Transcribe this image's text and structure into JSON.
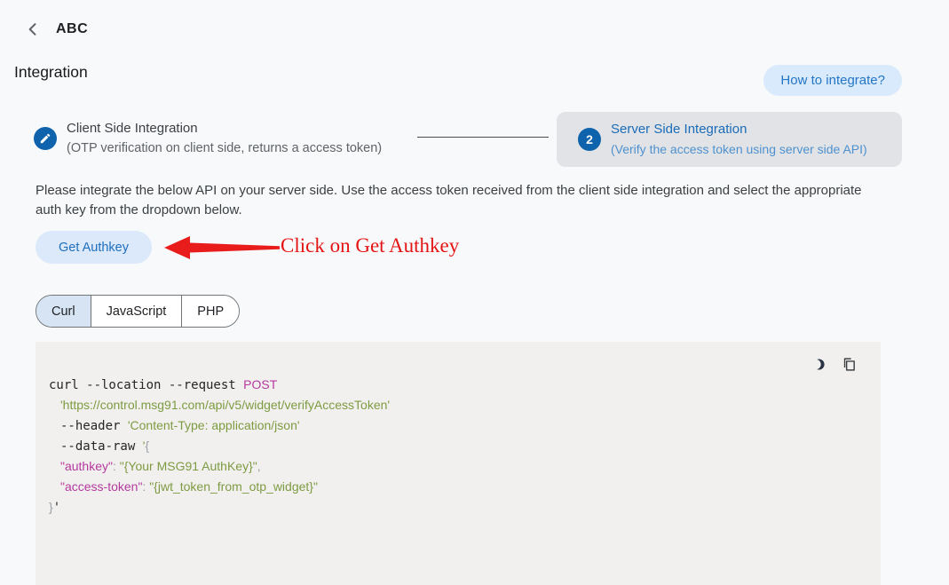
{
  "header": {
    "back_icon": "chevron-left",
    "title": "ABC"
  },
  "page": {
    "title": "Integration",
    "how_to_button": "How to integrate?"
  },
  "steps": {
    "client": {
      "icon": "pencil-icon",
      "title": "Client Side Integration",
      "subtitle": "(OTP verification on client side, returns a access token)"
    },
    "server": {
      "number": "2",
      "title": "Server Side Integration",
      "subtitle": "(Verify the access token using server side API)"
    }
  },
  "instructions": "Please integrate the below API on your server side. Use the access token received from the client side integration and select the appropriate auth key from the dropdown below.",
  "authkey_button": "Get Authkey",
  "annotation": {
    "text": "Click on Get Authkey",
    "color": "#e41414"
  },
  "tabs": [
    {
      "label": "Curl",
      "selected": true
    },
    {
      "label": "JavaScript",
      "selected": false
    },
    {
      "label": "PHP",
      "selected": false
    }
  ],
  "code": {
    "toolbar": {
      "icons": [
        "dark-mode-moon",
        "copy"
      ]
    },
    "lines": [
      {
        "indent": 0,
        "tokens": [
          {
            "t": "curl --location --request ",
            "s": "cmd"
          },
          {
            "t": "POST",
            "s": "key"
          }
        ]
      },
      {
        "indent": 1,
        "tokens": [
          {
            "t": "'https://control.msg91.com/api/v5/widget/verifyAccessToken'",
            "s": "str"
          }
        ]
      },
      {
        "indent": 1,
        "tokens": [
          {
            "t": "--header ",
            "s": "cmd"
          },
          {
            "t": "'Content-Type: application/json'",
            "s": "str"
          }
        ]
      },
      {
        "indent": 1,
        "tokens": [
          {
            "t": "--data-raw ",
            "s": "cmd"
          },
          {
            "t": "'",
            "s": "str"
          },
          {
            "t": "{",
            "s": "pun"
          }
        ]
      },
      {
        "indent": 1,
        "tokens": [
          {
            "t": "\"authkey\"",
            "s": "key"
          },
          {
            "t": ": ",
            "s": "pun"
          },
          {
            "t": "\"{Your MSG91 AuthKey}\"",
            "s": "str"
          },
          {
            "t": ",",
            "s": "pun"
          }
        ]
      },
      {
        "indent": 1,
        "tokens": [
          {
            "t": "\"access-token\"",
            "s": "key"
          },
          {
            "t": ": ",
            "s": "pun"
          },
          {
            "t": "\"{jwt_token_from_otp_widget}\"",
            "s": "str"
          }
        ]
      },
      {
        "indent": 0,
        "tokens": [
          {
            "t": "}",
            "s": "pun"
          },
          {
            "t": "'",
            "s": "cmd"
          }
        ]
      }
    ]
  },
  "colors": {
    "accent_blue": "#0f62ac",
    "light_blue_bg": "#dbe9fa",
    "blue_text": "#1e6fbe",
    "step_card_bg": "#e2e3e6",
    "code_bg": "#f2f0ee",
    "code_command": "#262626",
    "code_key": "#b5399f",
    "code_string": "#7d9b42",
    "code_punctuation": "#9aa0a6",
    "annotation_red": "#e41414"
  }
}
